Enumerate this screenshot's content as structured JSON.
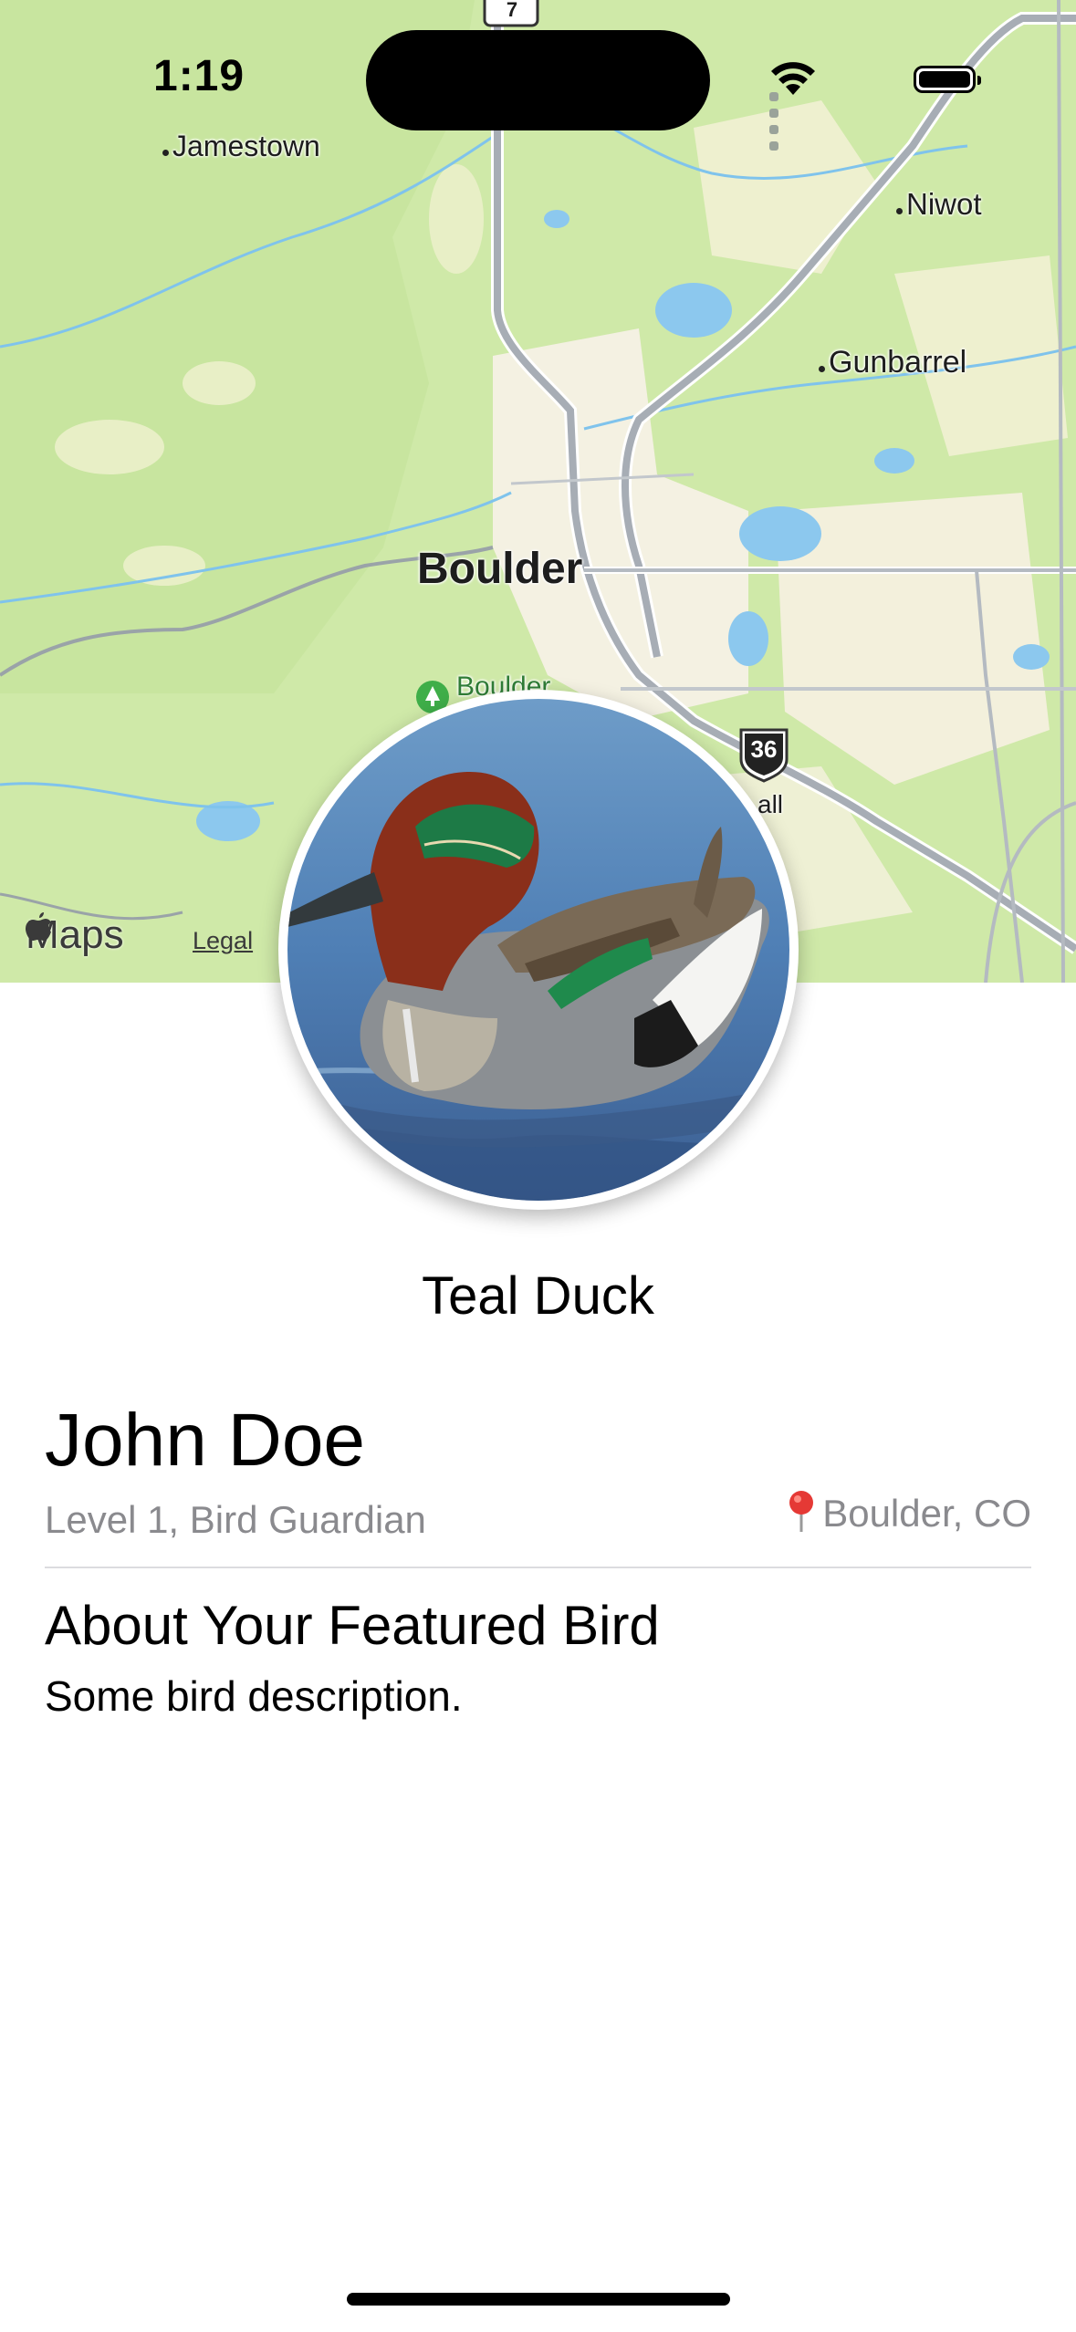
{
  "status_bar": {
    "time": "1:19"
  },
  "map": {
    "road_shield": "7",
    "highway_shield": "36",
    "places": {
      "jamestown": "Jamestown",
      "niwot": "Niwot",
      "gunbarrel": "Gunbarrel",
      "boulder": "Boulder",
      "boulder_poi": "Boulder",
      "partial_all": "all"
    },
    "attribution": "Maps",
    "legal": "Legal"
  },
  "featured_bird": {
    "name": "Teal Duck"
  },
  "profile": {
    "name": "John Doe",
    "level": "Level 1, Bird Guardian",
    "location": "Boulder, CO"
  },
  "about": {
    "title": "About Your Featured Bird",
    "description": "Some bird description."
  },
  "colors": {
    "map_land": "#cfe9a8",
    "map_urban": "#f4f1e2",
    "map_water": "#8cc8ee",
    "secondary_text": "#8a8a8e"
  }
}
